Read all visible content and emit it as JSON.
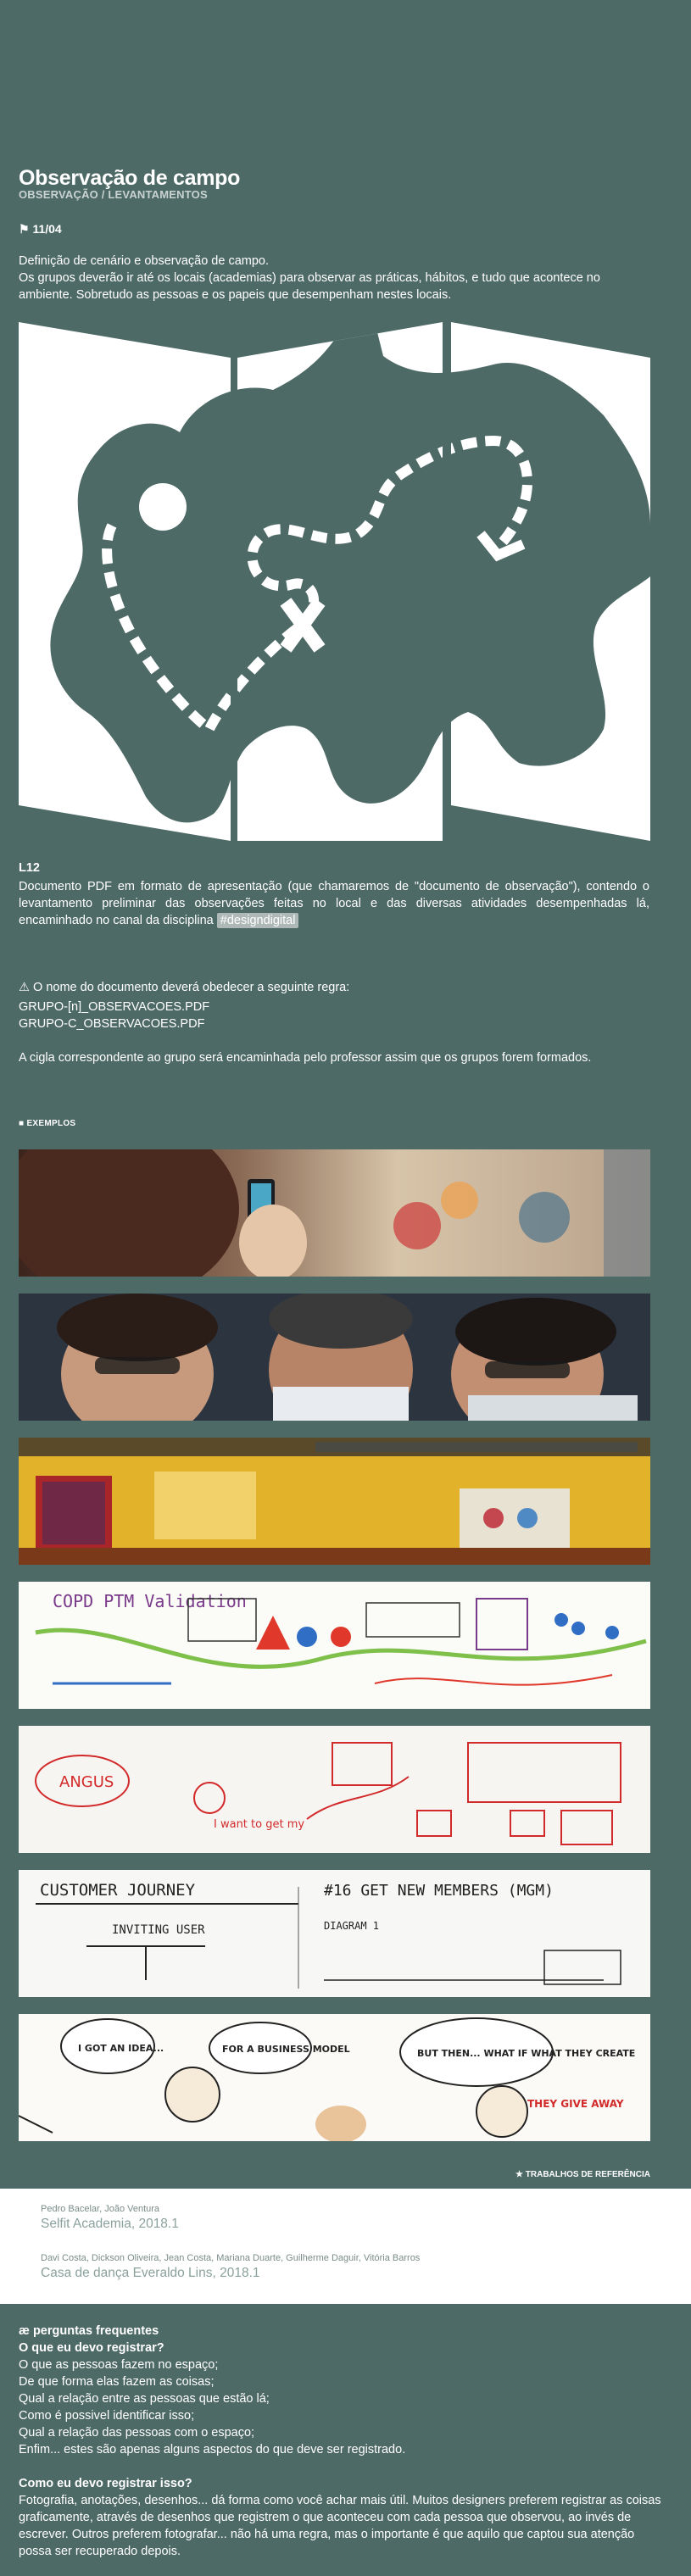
{
  "header": {
    "title": "Observação de campo",
    "subtitle": "OBSERVAÇÃO / LEVANTAMENTOS",
    "date_icon": "flag-icon",
    "date": "11/04"
  },
  "intro": {
    "line1": "Definição de cenário e observação de campo.",
    "line2": "Os grupos deverão ir até os locais (academias) para observar as práticas, hábitos, e tudo que acontece no ambiente. Sobretudo as pessoas e os papeis que desempenham nestes locais."
  },
  "assignment": {
    "code": "L12",
    "text": "Documento PDF em formato de apresentação (que chamaremos de \"documento de observação\"), contendo o levantamento preliminar das observações feitas no local e das diversas atividades desempenhadas lá, encaminhado no canal da disciplina",
    "tag": "#designdigital"
  },
  "naming": {
    "warning_icon": "warning-icon",
    "title": "O nome do documento deverá obedecer a seguinte regra:",
    "pattern": "GRUPO-[n]_OBSERVACOES.PDF",
    "example": "GRUPO-C_OBSERVACOES.PDF",
    "note": "A cigla correspondente ao grupo será encaminhada pelo professor assim que os grupos forem formados."
  },
  "examples": {
    "label": "EXEMPLOS",
    "images": [
      {
        "name": "selfie-photo"
      },
      {
        "name": "scientists-photo"
      },
      {
        "name": "classroom-photo"
      },
      {
        "name": "sketchnote-validation"
      },
      {
        "name": "whiteboard-sketch"
      },
      {
        "name": "customer-journey-sketch"
      },
      {
        "name": "comic-business-model"
      }
    ],
    "sketch_texts": {
      "validation": "COPD PTM Validation",
      "angus": "ANGUS",
      "want": "I want to get my",
      "journey": "CUSTOMER JOURNEY",
      "inviting": "INVITING USER",
      "mgm": "#16 GET NEW MEMBERS (MGM)",
      "diagram": "DIAGRAM 1",
      "idea": "I GOT AN IDEA...",
      "business": "FOR A BUSINESS MODEL",
      "butthen": "BUT THEN... WHAT IF WHAT THEY CREATE",
      "give": "THEY GIVE AWAY"
    }
  },
  "references": {
    "label": "TRABALHOS DE REFERÊNCIA",
    "star_icon": "star-icon",
    "items": [
      {
        "names": "Pedro Bacelar, João Ventura",
        "work": "Selfit Academia, 2018.1"
      },
      {
        "names": "Davi Costa, Dickson Oliveira, Jean Costa, Mariana Duarte, Guilherme Daguir, Vitória Barros",
        "work": "Casa de dança Everaldo Lins, 2018.1"
      }
    ]
  },
  "faq": {
    "label": "perguntas frequentes",
    "label_icon": "ae-icon",
    "q1": "O que eu devo registrar?",
    "a1": [
      "O que as pessoas fazem no espaço;",
      "De que forma elas fazem as coisas;",
      "Qual a relação entre as pessoas que estão lá;",
      "Como é possivel identificar isso;",
      "Qual a relação das pessoas com o espaço;",
      "Enfim... estes são apenas alguns aspectos do que deve ser registrado."
    ],
    "q2": "Como eu devo registrar isso?",
    "a2": "Fotografia, anotações, desenhos... dá forma como você achar mais útil. Muitos designers preferem registrar as coisas graficamente, através de desenhos que registrem o que aconteceu com cada pessoa que observou, ao invés de escrever. Outros preferem fotografar... não há uma regra, mas o importante é que aquilo que captou sua atenção possa ser recuperado depois."
  },
  "colors": {
    "background": "#4e6a66",
    "text": "#ffffff",
    "tag": "#aeb9b7",
    "refs_background": "#ffffff",
    "refs_text": "#8ba19d"
  }
}
